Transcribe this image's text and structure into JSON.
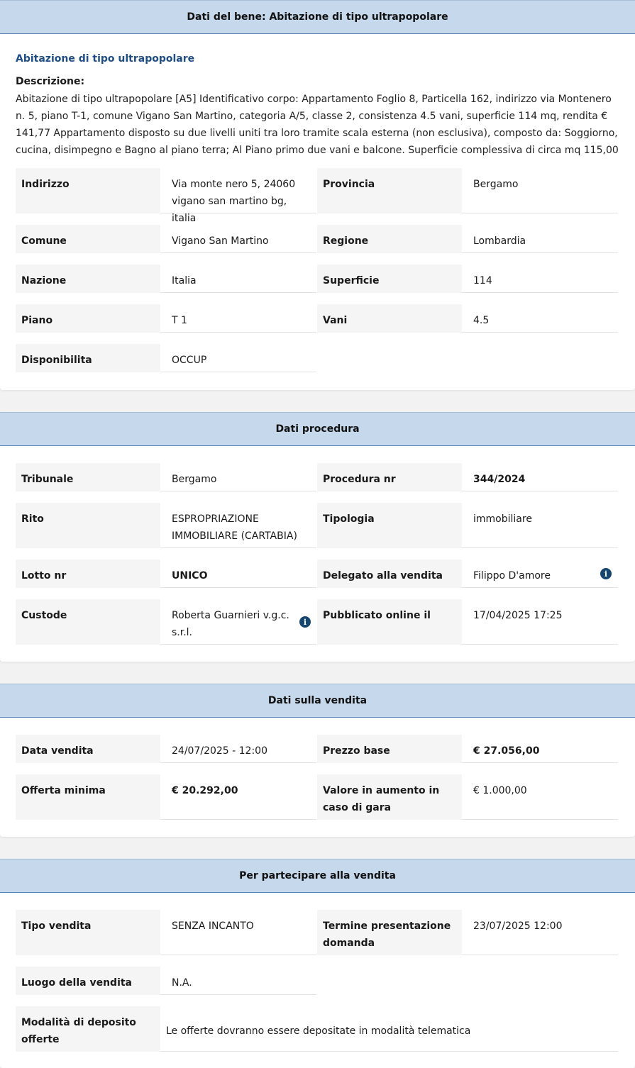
{
  "bene": {
    "header": "Dati del bene: Abitazione di tipo ultrapopolare",
    "subtitle": "Abitazione di tipo ultrapopolare",
    "desc_label": "Descrizione:",
    "desc_text": "Abitazione di tipo ultrapopolare [A5] Identificativo corpo: Appartamento Foglio 8, Particella 162, indirizzo via Montenero n. 5, piano T-1, comune Vigano San Martino, categoria A/5, classe 2, consistenza 4.5 vani, superficie 114 mq, rendita € 141,77 Appartamento disposto su due livelli uniti tra loro tramite scala esterna (non esclusiva), composto da: Soggiorno, cucina, disimpegno e Bagno al piano terra; Al Piano primo due vani e balcone. Superficie complessiva di circa mq 115,00",
    "rows": [
      {
        "l1": "Indirizzo",
        "v1": "Via monte nero 5, 24060 vigano san martino bg, italia",
        "l2": "Provincia",
        "v2": "Bergamo"
      },
      {
        "l1": "Comune",
        "v1": "Vigano San Martino",
        "l2": "Regione",
        "v2": "Lombardia"
      },
      {
        "l1": "Nazione",
        "v1": "Italia",
        "l2": "Superficie",
        "v2": "114"
      },
      {
        "l1": "Piano",
        "v1": "T 1",
        "l2": "Vani",
        "v2": "4.5"
      },
      {
        "l1": "Disponibilita",
        "v1": "OCCUP"
      }
    ]
  },
  "procedura": {
    "header": "Dati procedura",
    "rows": [
      {
        "l1": "Tribunale",
        "v1": "Bergamo",
        "l2": "Procedura nr",
        "v2": "344/2024"
      },
      {
        "l1": "Rito",
        "v1": "ESPROPRIAZIONE IMMOBILIARE (CARTABIA)",
        "l2": "Tipologia",
        "v2": "immobiliare"
      },
      {
        "l1": "Lotto nr",
        "v1": "UNICO",
        "l2": "Delegato alla vendita",
        "v2": "Filippo D'amore"
      },
      {
        "l1": "Custode",
        "v1": "Roberta Guarnieri v.g.c. s.r.l.",
        "l2": "Pubblicato online il",
        "v2": "17/04/2025 17:25"
      }
    ]
  },
  "vendita": {
    "header": "Dati sulla vendita",
    "rows": [
      {
        "l1": "Data vendita",
        "v1": "24/07/2025 - 12:00",
        "l2": "Prezzo base",
        "v2": "€ 27.056,00"
      },
      {
        "l1": "Offerta minima",
        "v1": "€ 20.292,00",
        "l2": "Valore in aumento in caso di gara",
        "v2": "€ 1.000,00"
      }
    ]
  },
  "partecipare": {
    "header": "Per partecipare alla vendita",
    "rows": [
      {
        "l1": "Tipo vendita",
        "v1": "SENZA INCANTO",
        "l2": "Termine presentazione domanda",
        "v2": "23/07/2025 12:00"
      },
      {
        "l1": "Luogo della vendita",
        "v1": "N.A."
      },
      {
        "l1": "Modalità di deposito offerte",
        "v1": "Le offerte dovranno essere depositate in modalità telematica"
      }
    ]
  },
  "icons": {
    "info": "info-icon",
    "info_glyph": "i"
  }
}
